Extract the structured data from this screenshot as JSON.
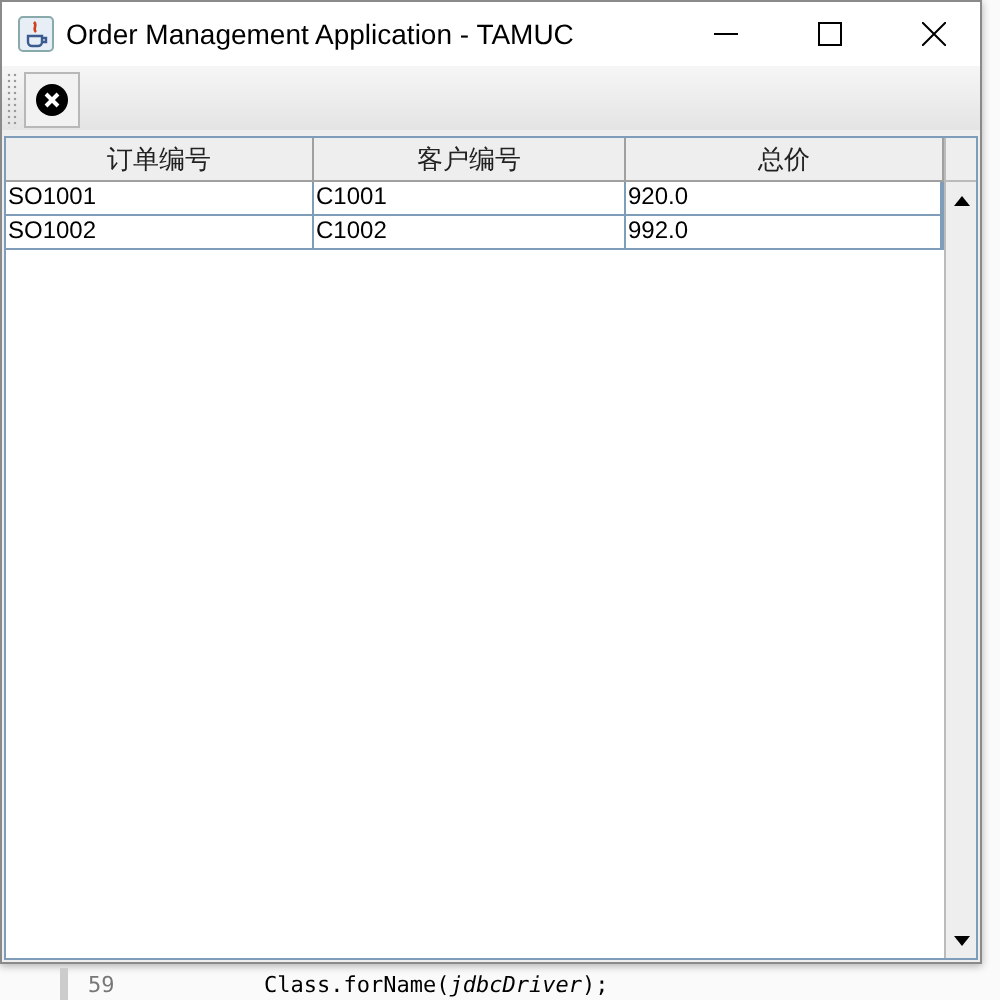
{
  "window": {
    "title": "Order Management Application - TAMUC"
  },
  "toolbar": {
    "buttons": [
      {
        "kind": "close"
      }
    ]
  },
  "table": {
    "columns": [
      "订单编号",
      "客户编号",
      "总价"
    ],
    "rows": [
      [
        "SO1001",
        "C1001",
        "920.0"
      ],
      [
        "SO1002",
        "C1002",
        "992.0"
      ]
    ]
  },
  "background_editor": {
    "line_number": "59",
    "code": "Class.forName(*jdbcDriver*);"
  }
}
